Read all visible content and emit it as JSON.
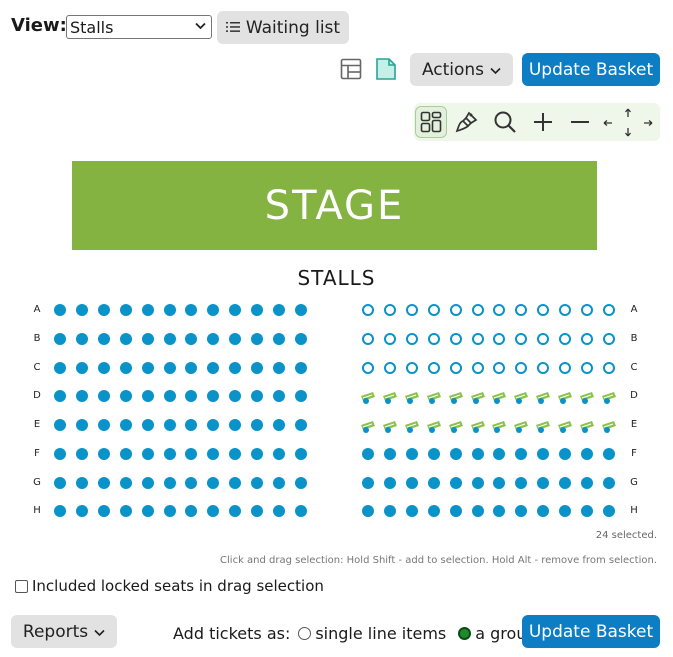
{
  "header": {
    "view_label": "View:",
    "view_select_value": "Stalls",
    "waiting_list_label": "Waiting list",
    "actions_label": "Actions",
    "update_basket_label": "Update Basket"
  },
  "stage": {
    "label": "STAGE",
    "color": "#84b342"
  },
  "section": {
    "title": "STALLS"
  },
  "rows": [
    "A",
    "B",
    "C",
    "D",
    "E",
    "F",
    "G",
    "H"
  ],
  "seat_colors": {
    "sold": "#0a93c9",
    "available_outline": "#0a93c9",
    "selected_icon": "#8bc34a"
  },
  "blocks": {
    "left": {
      "seats_per_row": 12,
      "rows": {
        "A": "sold",
        "B": "sold",
        "C": "sold",
        "D": "sold",
        "E": "sold",
        "F": "sold",
        "G": "sold",
        "H": "sold"
      }
    },
    "right": {
      "seats_per_row": 12,
      "rows": {
        "A": "available",
        "B": "available",
        "C": "available",
        "D": "selected",
        "E": "selected",
        "F": "sold",
        "G": "sold",
        "H": "sold"
      }
    }
  },
  "status": {
    "selected_count": "24 selected.",
    "drag_hint": "Click and drag selection: Hold Shift - add to selection. Hold Alt - remove from selection."
  },
  "options": {
    "locked_seats_label": "Included locked seats in drag selection",
    "locked_seats_checked": false
  },
  "footer": {
    "reports_label": "Reports",
    "add_tickets_label": "Add tickets as:",
    "single_line_items_label": "single line items",
    "group_label": "a group",
    "selected_mode": "group",
    "update_basket_label": "Update Basket"
  },
  "icons": {
    "list": "list-icon",
    "table": "table-view-icon",
    "page": "page-view-icon",
    "grid": "grid-layout-icon",
    "brush": "paint-brush-icon",
    "search": "magnifier-icon",
    "zoom_in": "plus-icon",
    "zoom_out": "minus-icon",
    "pan": "pan-arrows-icon"
  }
}
